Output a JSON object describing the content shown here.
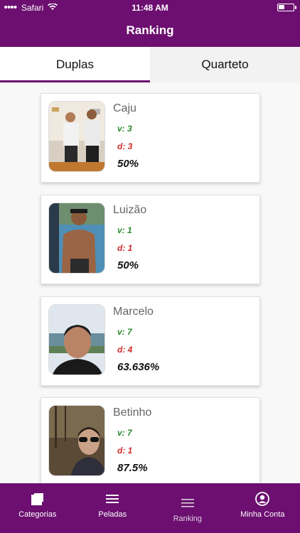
{
  "status": {
    "carrier": "Safari",
    "time": "11:48 AM"
  },
  "header": {
    "title": "Ranking"
  },
  "tabs": [
    {
      "label": "Duplas",
      "active": true
    },
    {
      "label": "Quarteto",
      "active": false
    }
  ],
  "players": [
    {
      "name": "Caju",
      "wins": "v: 3",
      "losses": "d: 3",
      "percent": "50%"
    },
    {
      "name": "Luizão",
      "wins": "v: 1",
      "losses": "d: 1",
      "percent": "50%"
    },
    {
      "name": "Marcelo",
      "wins": "v: 7",
      "losses": "d: 4",
      "percent": "63.636%"
    },
    {
      "name": "Betinho",
      "wins": "v: 7",
      "losses": "d: 1",
      "percent": "87.5%"
    }
  ],
  "nav": [
    {
      "label": "Categorias",
      "icon": "cards-icon"
    },
    {
      "label": "Peladas",
      "icon": "menu-icon"
    },
    {
      "label": "Ranking",
      "icon": "menu-icon"
    },
    {
      "label": "Minha Conta",
      "icon": "user-circle-icon"
    }
  ],
  "colors": {
    "primary": "#6c0f70",
    "win": "#2c8a2c",
    "loss": "#d12a2a"
  }
}
